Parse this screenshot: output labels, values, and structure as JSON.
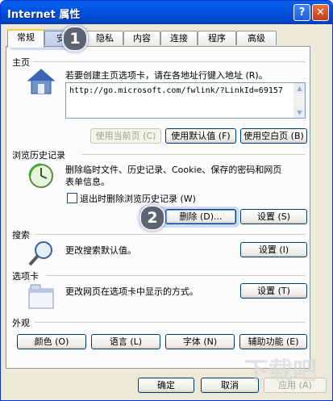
{
  "window": {
    "title": "Internet 属性",
    "help_glyph": "?",
    "close_glyph": "✕"
  },
  "tabs": [
    "常规",
    "安全",
    "隐私",
    "内容",
    "连接",
    "程序",
    "高级"
  ],
  "homepage": {
    "label": "主页",
    "description": "若要创建主页选项卡，请在各地址行键入地址 (R)。",
    "url": "http://go.microsoft.com/fwlink/?LinkId=69157",
    "buttons": [
      "使用当前页 (C)",
      "使用默认值 (F)",
      "使用空白页 (B)"
    ]
  },
  "history": {
    "label": "浏览历史记录",
    "description_line1": "删除临时文件、历史记录、Cookie、保存的密码和网页",
    "description_line2": "表单信息。",
    "checkbox_label": "退出时删除浏览历史记录 (W)",
    "delete_button": "删除 (D)...",
    "settings_button": "设置 (S)"
  },
  "search": {
    "label": "搜索",
    "description": "更改搜索默认值。",
    "settings_button": "设置 (I)"
  },
  "tabs_section": {
    "label": "选项卡",
    "description": "更改网页在选项卡中显示的方式。",
    "settings_button": "设置 (T)"
  },
  "appearance": {
    "label": "外观",
    "buttons": [
      "颜色 (O)",
      "语言 (L)",
      "字体 (N)",
      "辅助功能 (E)"
    ]
  },
  "footer": {
    "ok": "确定",
    "cancel": "取消",
    "apply": "应用 (A)"
  },
  "callouts": [
    "1",
    "2"
  ],
  "colors": {
    "titlebar": "#0054e3",
    "callout": "#5b6470",
    "tab_accent": "#ffc83c"
  }
}
